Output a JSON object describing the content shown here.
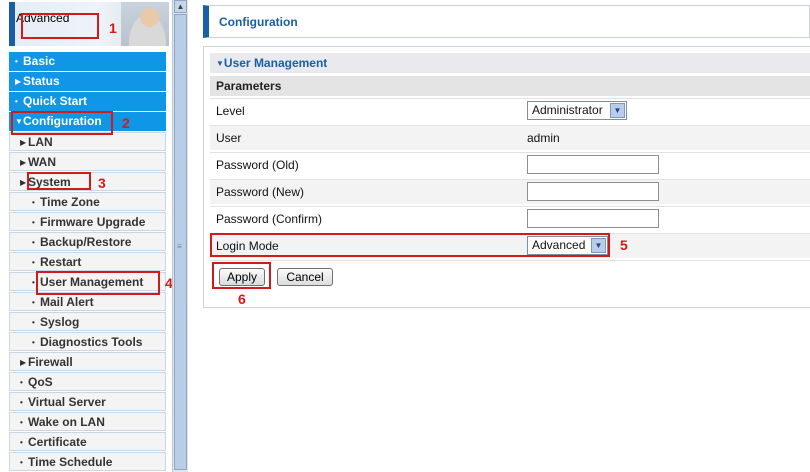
{
  "banner": {
    "label": "Advanced"
  },
  "menu": {
    "items": [
      {
        "label": "Basic",
        "level": "top"
      },
      {
        "label": "Status",
        "level": "top"
      },
      {
        "label": "Quick Start",
        "level": "top"
      },
      {
        "label": "Configuration",
        "level": "top"
      },
      {
        "label": "LAN",
        "level": "sub"
      },
      {
        "label": "WAN",
        "level": "sub"
      },
      {
        "label": "System",
        "level": "sub"
      },
      {
        "label": "Time Zone",
        "level": "sub2"
      },
      {
        "label": "Firmware Upgrade",
        "level": "sub2"
      },
      {
        "label": "Backup/Restore",
        "level": "sub2"
      },
      {
        "label": "Restart",
        "level": "sub2"
      },
      {
        "label": "User Management",
        "level": "sub2"
      },
      {
        "label": "Mail Alert",
        "level": "sub2"
      },
      {
        "label": "Syslog",
        "level": "sub2"
      },
      {
        "label": "Diagnostics Tools",
        "level": "sub2"
      },
      {
        "label": "Firewall",
        "level": "sub"
      },
      {
        "label": "QoS",
        "level": "sub"
      },
      {
        "label": "Virtual Server",
        "level": "sub"
      },
      {
        "label": "Wake on LAN",
        "level": "sub"
      },
      {
        "label": "Certificate",
        "level": "sub"
      },
      {
        "label": "Time Schedule",
        "level": "sub"
      }
    ]
  },
  "annotations": {
    "n1": "1",
    "n2": "2",
    "n3": "3",
    "n4": "4",
    "n5": "5",
    "n6": "6"
  },
  "content": {
    "page_title": "Configuration",
    "section_title": "User Management",
    "params_header": "Parameters",
    "level": {
      "label": "Level",
      "value": "Administrator"
    },
    "user": {
      "label": "User",
      "value": "admin"
    },
    "password_old": {
      "label": "Password (Old)",
      "value": ""
    },
    "password_new": {
      "label": "Password (New)",
      "value": ""
    },
    "password_confirm": {
      "label": "Password (Confirm)",
      "value": ""
    },
    "login_mode": {
      "label": "Login Mode",
      "value": "Advanced"
    },
    "apply_label": "Apply",
    "cancel_label": "Cancel"
  },
  "colors": {
    "accent": "#1a5ea8",
    "menu_top": "#0f96e6",
    "annotation": "#d31a1a"
  }
}
